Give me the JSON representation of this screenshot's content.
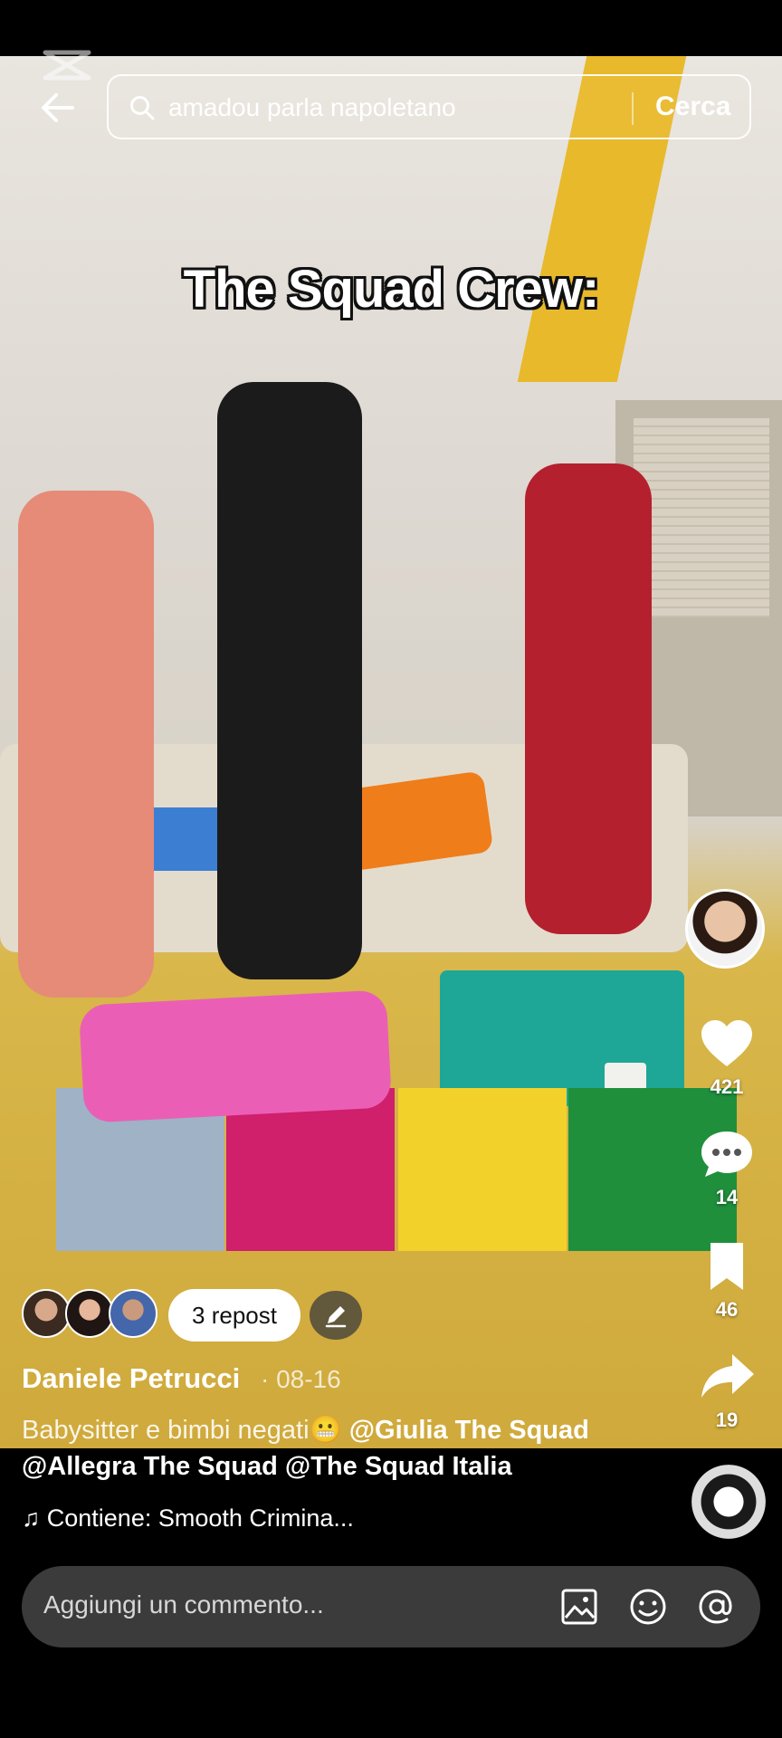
{
  "search": {
    "query": "amadou parla napoletano",
    "submit_label": "Cerca"
  },
  "video": {
    "overlay_text": "The Squad Crew:"
  },
  "actions": {
    "likes": "421",
    "comments": "14",
    "saves": "46",
    "shares": "19"
  },
  "reposts": {
    "label": "3 repost"
  },
  "post": {
    "author": "Daniele Petrucci",
    "date": "· 08-16",
    "caption_text": "Babysitter e bimbi negati😬 ",
    "caption_mention1": "@Giulia The Squad",
    "caption_line2": "@Allegra The Squad @The Squad Italia",
    "music": "♫ Contiene: Smooth Crimina..."
  },
  "comment": {
    "placeholder": "Aggiungi un commento..."
  },
  "icons": [
    "back-arrow-icon",
    "search-icon",
    "heart-icon",
    "comment-icon",
    "bookmark-icon",
    "share-icon",
    "edit-icon",
    "image-icon",
    "emoji-icon",
    "mention-icon",
    "music-note-icon"
  ],
  "colors": {
    "comment_bar_bg": "#3b3b3b",
    "repost_pill_bg": "#ffffff"
  }
}
